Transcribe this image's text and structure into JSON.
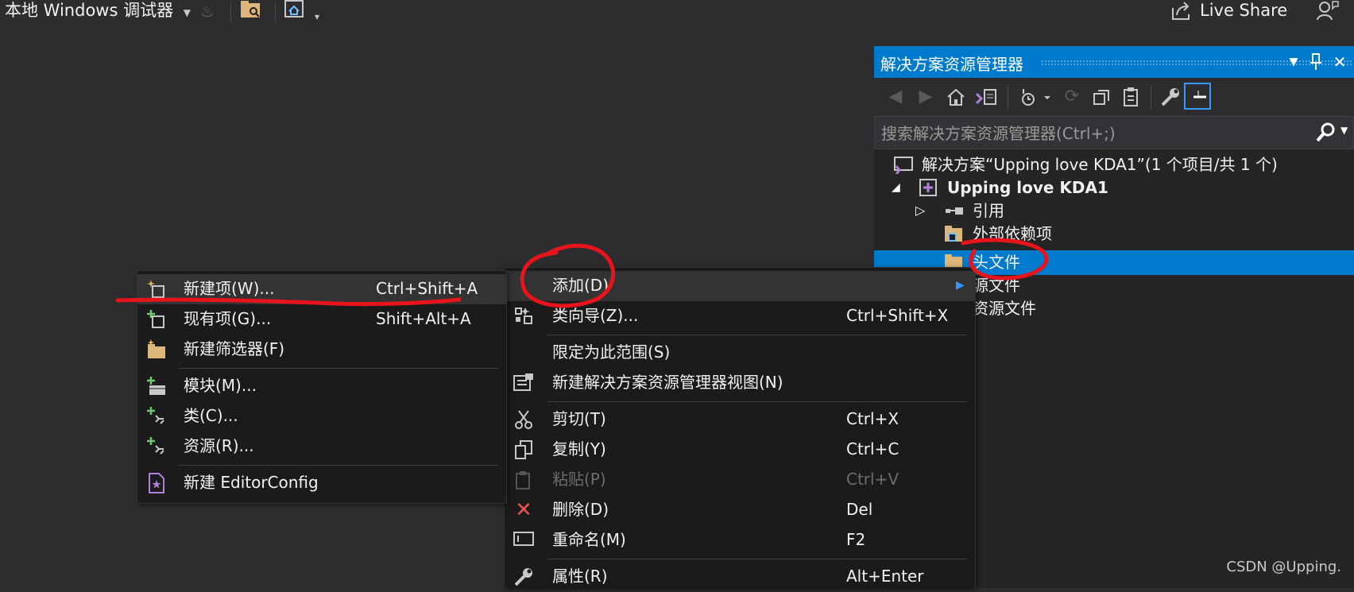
{
  "toolbar": {
    "debugger_label": "本地 Windows 调试器",
    "live_share_label": "Live Share"
  },
  "solution_explorer": {
    "title": "解决方案资源管理器",
    "search_placeholder": "搜索解决方案资源管理器(Ctrl+;)",
    "tree": {
      "solution": "解决方案“Upping love KDA1”(1 个项目/共 1 个)",
      "project": "Upping love KDA1",
      "references": "引用",
      "external_deps": "外部依赖项",
      "header_files": "头文件",
      "source_files": "源文件",
      "resource_files": "资源文件"
    }
  },
  "context_menu": {
    "add": "添加(D)",
    "class_wizard": {
      "label": "类向导(Z)...",
      "shortcut": "Ctrl+Shift+X"
    },
    "scope_to_this": "限定为此范围(S)",
    "new_se_view": "新建解决方案资源管理器视图(N)",
    "cut": {
      "label": "剪切(T)",
      "shortcut": "Ctrl+X"
    },
    "copy": {
      "label": "复制(Y)",
      "shortcut": "Ctrl+C"
    },
    "paste": {
      "label": "粘贴(P)",
      "shortcut": "Ctrl+V"
    },
    "delete": {
      "label": "删除(D)",
      "shortcut": "Del"
    },
    "rename": {
      "label": "重命名(M)",
      "shortcut": "F2"
    },
    "properties": {
      "label": "属性(R)",
      "shortcut": "Alt+Enter"
    }
  },
  "add_submenu": {
    "new_item": {
      "label": "新建项(W)...",
      "shortcut": "Ctrl+Shift+A"
    },
    "existing_item": {
      "label": "现有项(G)...",
      "shortcut": "Shift+Alt+A"
    },
    "new_filter": "新建筛选器(F)",
    "module": "模块(M)...",
    "class": "类(C)...",
    "resource": "资源(R)...",
    "editorconfig": "新建 EditorConfig"
  },
  "watermark": "CSDN @Upping.",
  "colors": {
    "accent": "#007acc",
    "background": "#2d2d30",
    "annotation": "#e8141c"
  }
}
